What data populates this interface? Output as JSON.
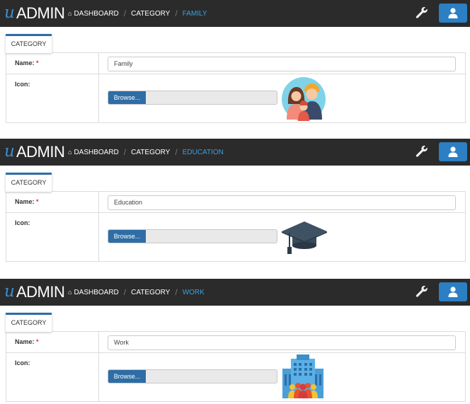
{
  "app": {
    "logo_u": "u",
    "logo_admin": "ADMIN"
  },
  "panels": [
    {
      "breadcrumb": {
        "home_label": "DASHBOARD",
        "category_label": "CATEGORY",
        "current_label": "FAMILY"
      },
      "tab_label": "CATEGORY",
      "name_label": "Name:",
      "required_mark": "*",
      "name_value": "Family",
      "icon_label": "Icon:",
      "browse_label": "Browse...",
      "icon_image": "family-icon"
    },
    {
      "breadcrumb": {
        "home_label": "DASHBOARD",
        "category_label": "CATEGORY",
        "current_label": "EDUCATION"
      },
      "tab_label": "CATEGORY",
      "name_label": "Name:",
      "required_mark": "*",
      "name_value": "Education",
      "icon_label": "Icon:",
      "browse_label": "Browse...",
      "icon_image": "graduation-cap-icon"
    },
    {
      "breadcrumb": {
        "home_label": "DASHBOARD",
        "category_label": "CATEGORY",
        "current_label": "WORK"
      },
      "tab_label": "CATEGORY",
      "name_label": "Name:",
      "required_mark": "*",
      "name_value": "Work",
      "icon_label": "Icon:",
      "browse_label": "Browse...",
      "icon_image": "office-building-icon"
    }
  ],
  "colors": {
    "navbar": "#2b2b2b",
    "accent": "#2c7fc3",
    "breadcrumb_active": "#3a9fe0",
    "required": "#d9302c"
  }
}
